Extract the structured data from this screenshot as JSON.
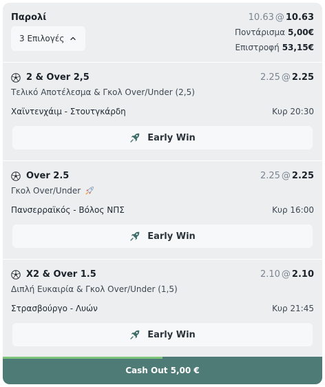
{
  "header": {
    "title": "Παρολί",
    "odds_old": "10.63",
    "odds_at": "@",
    "odds_new": "10.63",
    "selections_label": "3 Επιλογές",
    "stake_label": "Ποντάρισμα",
    "stake_value": "5,00€",
    "return_label": "Επιστροφή",
    "return_value": "53,15€"
  },
  "bets": [
    {
      "name": "2 & Over 2,5",
      "odds_old": "2.25",
      "odds_new": "2.25",
      "market": "Τελικό Αποτέλεσμα & Γκολ Over/Under (2,5)",
      "event": "Χαϊντενχάιμ - Στουτγκάρδη",
      "time": "Κυρ 20:30",
      "early_win": "Early Win",
      "has_rocket": false
    },
    {
      "name": "Over 2.5",
      "odds_old": "2.25",
      "odds_new": "2.25",
      "market": "Γκολ Over/Under",
      "event": "Πανσερραϊκός - Βόλος ΝΠΣ",
      "time": "Κυρ 16:00",
      "early_win": "Early Win",
      "has_rocket": true
    },
    {
      "name": "X2 & Over 1.5",
      "odds_old": "2.10",
      "odds_new": "2.10",
      "market": "Διπλή Ευκαιρία & Γκολ Over/Under (1,5)",
      "event": "Στρασβούργο - Λυών",
      "time": "Κυρ 21:45",
      "early_win": "Early Win",
      "has_rocket": false
    }
  ],
  "cashout": {
    "label": "Cash Out 5,00 €",
    "progress_fraction": 0.5
  },
  "icons": {
    "ball": "soccer-ball-icon",
    "chevron": "chevron-up-icon",
    "early_win": "early-win-rocket-icon",
    "rocket": "rocket-icon"
  },
  "colors": {
    "card_bg": "#eceef0",
    "button_bg": "#f7f8f9",
    "cashout_bg": "#4f7b77",
    "progress": "#7cc57a"
  }
}
